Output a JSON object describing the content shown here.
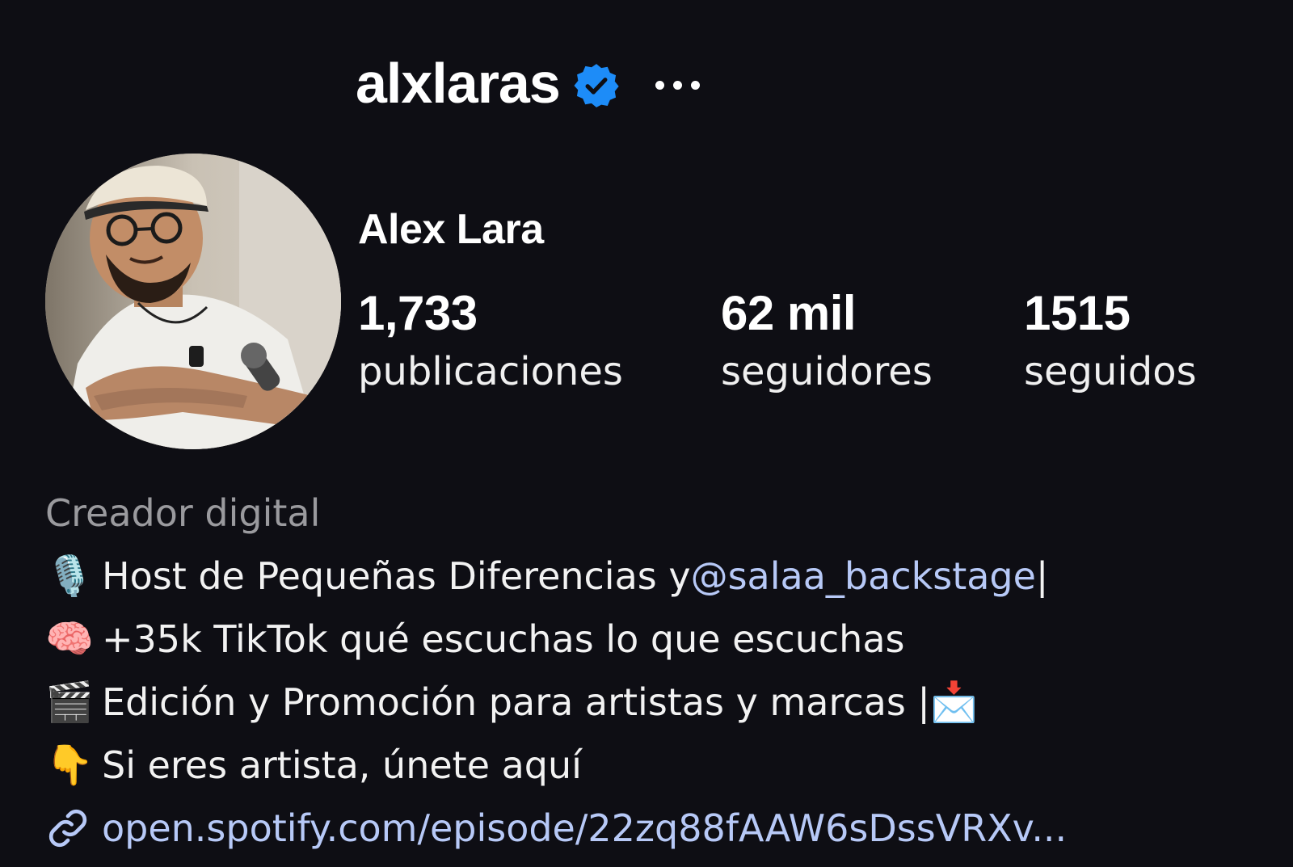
{
  "profile": {
    "username": "alxlaras",
    "verified": true,
    "verified_color": "#1d8cf8",
    "more_icon": "more-horizontal-icon",
    "full_name": "Alex Lara",
    "avatar_alt": "profile-photo"
  },
  "stats": [
    {
      "value": "1,733",
      "label": "publicaciones"
    },
    {
      "value": "62 mil",
      "label": "seguidores"
    },
    {
      "value": "1515",
      "label": "seguidos"
    }
  ],
  "bio": {
    "category": "Creador digital",
    "line1_emoji": "🎙️",
    "line1_text": "Host de Pequeñas Diferencias y ",
    "line1_mention": "@salaa_backstage",
    "line1_tail": " |",
    "line2_emoji": "🧠",
    "line2_text": "+35k TikTok qué escuchas lo que escuchas",
    "line3_emoji": "🎬",
    "line3_text": "Edición y Promoción para artistas y marcas | ",
    "line3_tail_emoji": "📩",
    "line4_emoji": "👇",
    "line4_text": "Si eres artista, únete aquí",
    "link_text": "open.spotify.com/episode/22zq88fAAW6sDssVRXv...",
    "link_icon": "link-icon",
    "link_color": "#b7c9f7"
  },
  "colors": {
    "background": "#0e0e14",
    "text": "#f5f5f5",
    "muted": "#9a9a9e",
    "accent_link": "#b7c9f7"
  }
}
